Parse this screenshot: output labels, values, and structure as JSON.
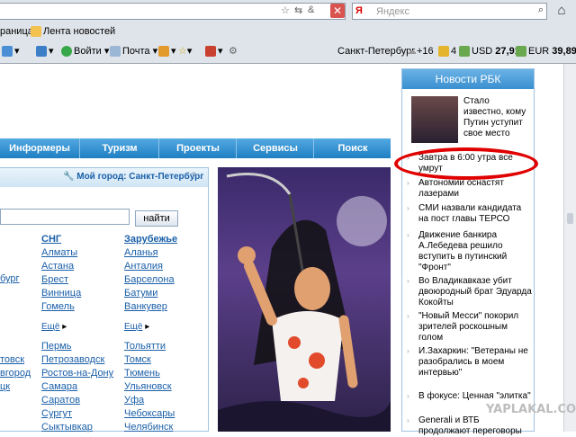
{
  "browser": {
    "search_placeholder": "Яндекс",
    "search_logo": "Я",
    "bookmarks": [
      "раница",
      "Лента новостей"
    ],
    "toolbar": {
      "login": "Войти",
      "mail": "Почта",
      "city": "Санкт-Петербург",
      "temp": "+16",
      "traffic": "4",
      "usd_label": "USD",
      "usd": "27,91",
      "eur_label": "EUR",
      "eur": "39,89"
    }
  },
  "nav": {
    "items": [
      "Информеры",
      "Туризм",
      "Проекты",
      "Сервисы",
      "Поиск"
    ]
  },
  "city_search": {
    "my_city": "Мой город: Санкт-Петербург",
    "find_button": "найти"
  },
  "cities": {
    "col1_partial": [
      "бург"
    ],
    "col2": {
      "head": "СНГ",
      "items": [
        "Алматы",
        "Астана",
        "Брест",
        "Винница",
        "Гомель"
      ],
      "more": "Ещё"
    },
    "col3": {
      "head": "Зарубежье",
      "items": [
        "Аланья",
        "Анталия",
        "Барселона",
        "Батуми",
        "Ванкувер"
      ],
      "more": "Ещё"
    },
    "col1_lower": [
      "товск",
      "вгород",
      "цк"
    ],
    "col2_lower": [
      "Пермь",
      "Петрозаводск",
      "Ростов-на-Дону",
      "Самара",
      "Саратов",
      "Сургут",
      "Сыктывкар"
    ],
    "col3_lower": [
      "Тольятти",
      "Томск",
      "Тюмень",
      "Ульяновск",
      "Уфа",
      "Чебоксары",
      "Челябинск"
    ]
  },
  "rbc": {
    "title": "Новости РБК",
    "news": [
      "Стало известно, кому Путин уступит свое место",
      "Завтра в 6:00 утра все умрут",
      "Автономии оснастят лазерами",
      "СМИ назвали кандидата на пост главы ТЕРСО",
      "Движение банкира А.Лебедева решило вступить в путинский \"Фронт\"",
      "Во Владикавказе убит двоюродный брат Эдуарда Кокойты",
      "\"Новый Месси\" покорил зрителей роскошным голом",
      "И.Захаркин: \"Ветераны не разобрались в моем интервью\"",
      "В фокусе: Ценная \"элитка\"",
      "Generali и ВТБ продолжают переговоры"
    ]
  },
  "watermark": "YAPLAKAL.COM",
  "colors": {
    "nav_blue": "#2f8fd0",
    "link": "#1a5fa8",
    "highlight_red": "#e00000"
  }
}
